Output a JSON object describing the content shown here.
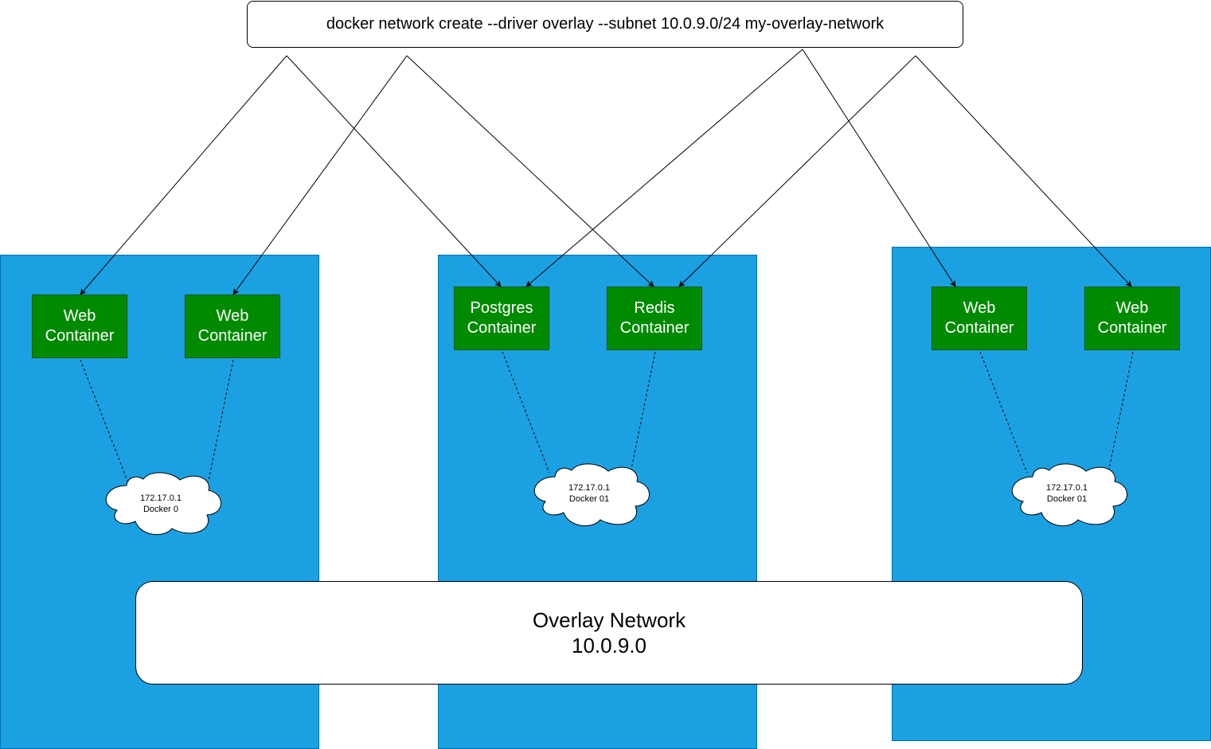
{
  "command": "docker network create --driver overlay --subnet 10.0.9.0/24 my-overlay-network",
  "hosts": [
    {
      "containers": [
        {
          "line1": "Web",
          "line2": "Container"
        },
        {
          "line1": "Web",
          "line2": "Container"
        }
      ],
      "bridge": {
        "ip": "172.17.0.1",
        "name": "Docker 0"
      }
    },
    {
      "containers": [
        {
          "line1": "Postgres",
          "line2": "Container"
        },
        {
          "line1": "Redis",
          "line2": "Container"
        }
      ],
      "bridge": {
        "ip": "172.17.0.1",
        "name": "Docker 01"
      }
    },
    {
      "containers": [
        {
          "line1": "Web",
          "line2": "Container"
        },
        {
          "line1": "Web",
          "line2": "Container"
        }
      ],
      "bridge": {
        "ip": "172.17.0.1",
        "name": "Docker 01"
      }
    }
  ],
  "overlay": {
    "title": "Overlay Network",
    "subnet": "10.0.9.0"
  },
  "colors": {
    "host_fill": "#1ba1e2",
    "container_fill": "#008a00",
    "container_text": "#ffffff",
    "line": "#000000"
  }
}
